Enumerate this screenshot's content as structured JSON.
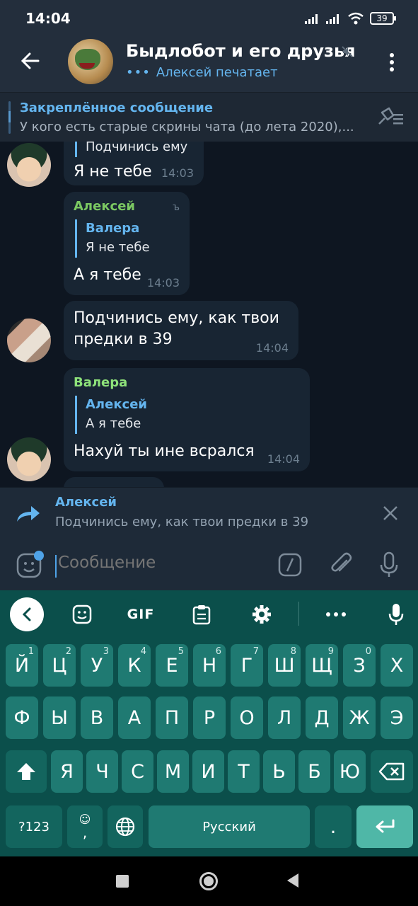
{
  "status_bar": {
    "time": "14:04",
    "battery": "39"
  },
  "header": {
    "title": "Быдлобот и его друзья",
    "typing_dots": "•••",
    "typing_status": "Алексей печатает"
  },
  "pinned": {
    "title": "Закреплённое сообщение",
    "text": "У кого есть старые скрины чата (до лета 2020),..."
  },
  "messages": [
    {
      "partial_reply": "Подчинись ему",
      "text": "Я не тебе",
      "time": "14:03"
    },
    {
      "sender": "Алексей",
      "edit_mark": "ъ",
      "reply_name": "Валера",
      "reply_text": "Я не тебе",
      "text": "А я тебе",
      "time": "14:03"
    },
    {
      "text": "Подчинись ему, как твои предки в 39",
      "time": "14:04"
    },
    {
      "sender": "Валера",
      "reply_name": "Алексей",
      "reply_text": "А я тебе",
      "text": "Нахуй ты ине всрался",
      "time": "14:04"
    }
  ],
  "reply_panel": {
    "name": "Алексей",
    "text": "Подчинись ему, как твои предки в 39"
  },
  "input": {
    "placeholder": "Сообщение"
  },
  "keyboard": {
    "toolbar": {
      "gif": "GIF"
    },
    "row1": [
      {
        "k": "Й",
        "s": "1"
      },
      {
        "k": "Ц",
        "s": "2"
      },
      {
        "k": "У",
        "s": "3"
      },
      {
        "k": "К",
        "s": "4"
      },
      {
        "k": "Е",
        "s": "5"
      },
      {
        "k": "Н",
        "s": "6"
      },
      {
        "k": "Г",
        "s": "7"
      },
      {
        "k": "Ш",
        "s": "8"
      },
      {
        "k": "Щ",
        "s": "9"
      },
      {
        "k": "З",
        "s": "0"
      },
      {
        "k": "Х",
        "s": ""
      }
    ],
    "row2": [
      "Ф",
      "Ы",
      "В",
      "А",
      "П",
      "Р",
      "О",
      "Л",
      "Д",
      "Ж",
      "Э"
    ],
    "row3": [
      "Я",
      "Ч",
      "С",
      "М",
      "И",
      "Т",
      "Ь",
      "Б",
      "Ю"
    ],
    "sym_key": "?123",
    "emoji_key_top": "☺",
    "emoji_key_bottom": ",",
    "space_label": "Русский",
    "period_key": "."
  },
  "colors": {
    "accent": "#64b5ef",
    "sender_green": "#7bc862",
    "keyboard_bg": "#0b4f4b",
    "key_bg": "#1f7a72"
  }
}
